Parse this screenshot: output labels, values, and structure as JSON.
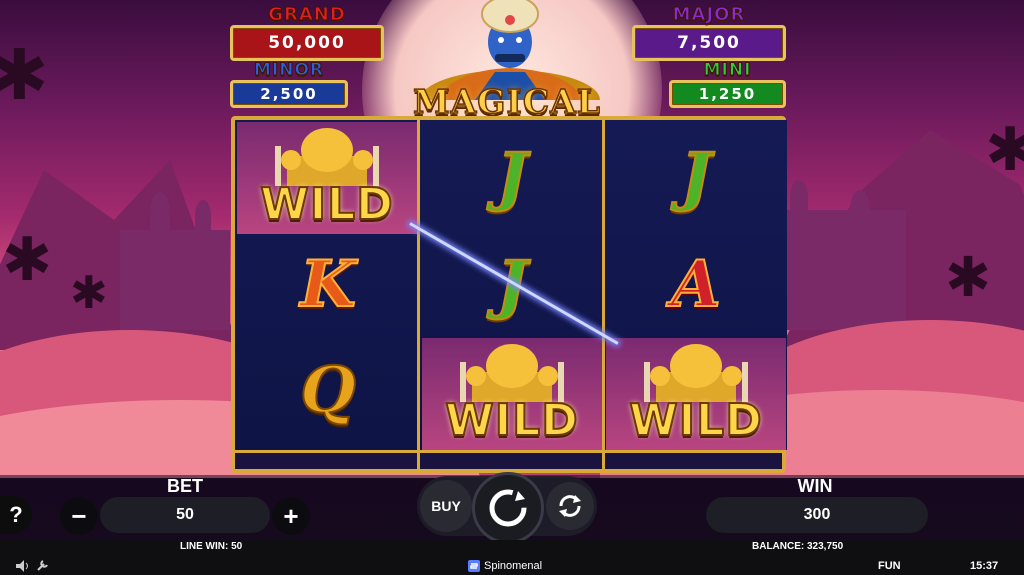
{
  "jackpots": {
    "grand": {
      "label": "GRAND",
      "value": "50,000",
      "label_color": "#e02020",
      "box_color": "#a81418"
    },
    "major": {
      "label": "MAJOR",
      "value": "7,500",
      "label_color": "#8a2bd0",
      "box_color": "#5a1a8a"
    },
    "minor": {
      "label": "MINOR",
      "value": "2,500",
      "label_color": "#2a5fe0",
      "box_color": "#1a3a9a"
    },
    "mini": {
      "label": "MINI",
      "value": "1,250",
      "label_color": "#2ecc40",
      "box_color": "#128a20"
    }
  },
  "game_title": "MAGICAL GENIE",
  "reels": [
    [
      {
        "type": "wild",
        "text": "WILD"
      },
      {
        "type": "K",
        "text": "K"
      },
      {
        "type": "Q",
        "text": "Q"
      }
    ],
    [
      {
        "type": "J",
        "text": "J"
      },
      {
        "type": "J",
        "text": "J"
      },
      {
        "type": "wild",
        "text": "WILD"
      }
    ],
    [
      {
        "type": "J",
        "text": "J"
      },
      {
        "type": "A",
        "text": "A"
      },
      {
        "type": "wild",
        "text": "WILD"
      }
    ]
  ],
  "controls": {
    "help_label": "?",
    "bet_label": "BET",
    "bet_value": "50",
    "minus_label": "−",
    "plus_label": "+",
    "buy_label": "BUY",
    "win_label": "WIN",
    "win_value": "300"
  },
  "status": {
    "line_win": "LINE WIN: 50",
    "balance": "BALANCE: 323,750",
    "provider": "Spinomenal",
    "mode": "FUN",
    "time": "15:37"
  },
  "icons": {
    "sound": "speaker-icon",
    "settings": "wrench-icon",
    "spin": "spin-icon",
    "autoplay": "autoplay-icon",
    "provider_logo": "spinomenal-logo-icon"
  }
}
